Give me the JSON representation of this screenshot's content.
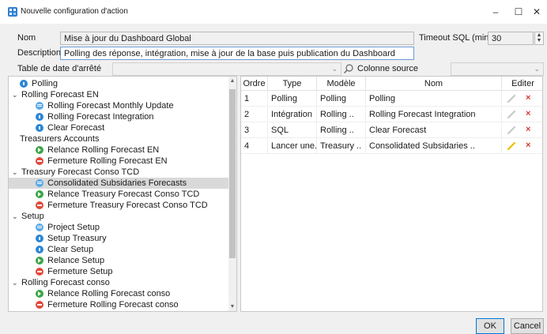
{
  "window": {
    "title": "Nouvelle configuration d'action",
    "minimize": "–",
    "maximize": "☐",
    "close": "✕"
  },
  "form": {
    "name_label": "Nom",
    "name_value": "Mise à jour du Dashboard Global",
    "timeout_label": "Timeout SQL (min)",
    "timeout_value": "30",
    "description_label": "Description",
    "description_value": "Polling des réponse, intégration, mise à jour de la base puis publication du Dashboard",
    "date_table_label": "Table de date d'arrêté",
    "source_column_label": "Colonne source"
  },
  "tree": {
    "items": [
      {
        "label": "Polling",
        "icon": "dot-blue",
        "indent": 1,
        "chev": ""
      },
      {
        "label": "Rolling Forecast EN",
        "icon": "",
        "indent": 0,
        "chev": "⌄"
      },
      {
        "label": "Rolling Forecast Monthly Update",
        "icon": "dot-lightblue",
        "indent": 2,
        "chev": ""
      },
      {
        "label": "Rolling Forecast Integration",
        "icon": "dot-blue",
        "indent": 2,
        "chev": ""
      },
      {
        "label": "Clear Forecast",
        "icon": "dot-blue",
        "indent": 2,
        "chev": ""
      },
      {
        "label": "Treasurers Accounts",
        "icon": "",
        "indent": 1,
        "chev": ""
      },
      {
        "label": "Relance Rolling Forecast EN",
        "icon": "dot-green",
        "indent": 2,
        "chev": ""
      },
      {
        "label": "Fermeture Rolling Forecast EN",
        "icon": "dot-red",
        "indent": 2,
        "chev": ""
      },
      {
        "label": "Treasury Forecast Conso TCD",
        "icon": "",
        "indent": 0,
        "chev": "⌄"
      },
      {
        "label": "Consolidated Subsidaries Forecasts",
        "icon": "dot-lightblue",
        "indent": 2,
        "chev": "",
        "selected": true
      },
      {
        "label": "Relance Treasury Forecast Conso TCD",
        "icon": "dot-green",
        "indent": 2,
        "chev": ""
      },
      {
        "label": "Fermeture Treasury Forecast Conso TCD",
        "icon": "dot-red",
        "indent": 2,
        "chev": ""
      },
      {
        "label": "Setup",
        "icon": "",
        "indent": 0,
        "chev": "⌄"
      },
      {
        "label": "Project Setup",
        "icon": "dot-lightblue",
        "indent": 2,
        "chev": ""
      },
      {
        "label": "Setup Treasury",
        "icon": "dot-blue",
        "indent": 2,
        "chev": ""
      },
      {
        "label": "Clear Setup",
        "icon": "dot-blue",
        "indent": 2,
        "chev": ""
      },
      {
        "label": "Relance Setup",
        "icon": "dot-green",
        "indent": 2,
        "chev": ""
      },
      {
        "label": "Fermeture Setup",
        "icon": "dot-red",
        "indent": 2,
        "chev": ""
      },
      {
        "label": "Rolling Forecast conso",
        "icon": "",
        "indent": 0,
        "chev": "⌄"
      },
      {
        "label": "Relance Rolling Forecast conso",
        "icon": "dot-green",
        "indent": 2,
        "chev": ""
      },
      {
        "label": "Fermeture Rolling Forecast conso",
        "icon": "dot-red",
        "indent": 2,
        "chev": ""
      }
    ]
  },
  "grid": {
    "headers": [
      "Ordre",
      "Type",
      "Modèle",
      "Nom",
      "Editer"
    ],
    "rows": [
      {
        "order": "1",
        "type": "Polling",
        "model": "Polling",
        "name": "Polling",
        "edit_active": false
      },
      {
        "order": "2",
        "type": "Intégration",
        "model": "Rolling ..",
        "name": "Rolling Forecast Integration",
        "edit_active": false
      },
      {
        "order": "3",
        "type": "SQL",
        "model": "Rolling ..",
        "name": "Clear Forecast",
        "edit_active": false
      },
      {
        "order": "4",
        "type": "Lancer une..",
        "model": "Treasury ..",
        "name": "Consolidated Subsidaries ..",
        "edit_active": true
      }
    ],
    "delete_glyph": "×"
  },
  "buttons": {
    "ok": "OK",
    "cancel": "Cancel"
  },
  "colors": {
    "selection": "#d9d9d9",
    "delete": "#d93a2b",
    "edit_active": "#e8c000",
    "edit_inactive": "#c8c8c8"
  }
}
